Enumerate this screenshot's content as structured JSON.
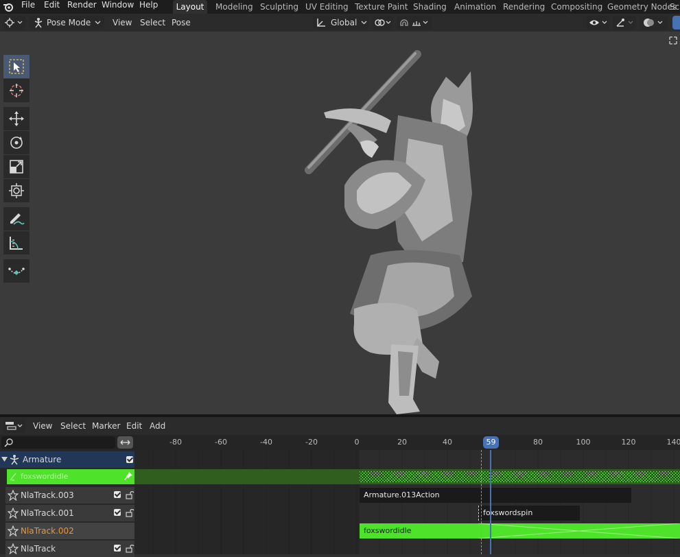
{
  "menu": {
    "items": [
      "File",
      "Edit",
      "Render",
      "Window",
      "Help"
    ]
  },
  "workspaces": {
    "tabs": [
      "Layout",
      "Modeling",
      "Sculpting",
      "UV Editing",
      "Texture Paint",
      "Shading",
      "Animation",
      "Rendering",
      "Compositing",
      "Geometry Nodes",
      "Sc"
    ],
    "active": "Layout"
  },
  "viewport_header": {
    "mode": "Pose Mode",
    "menus": [
      "View",
      "Select",
      "Pose"
    ],
    "orientation": "Global"
  },
  "toolbar": {
    "tools": [
      "select-box",
      "cursor",
      "move",
      "rotate",
      "scale",
      "transform",
      "annotate",
      "measure",
      "pose-breakdowner"
    ],
    "active": "select-box"
  },
  "nla_header": {
    "menus": [
      "View",
      "Select",
      "Marker",
      "Edit",
      "Add"
    ]
  },
  "timeline": {
    "ticks": [
      "-80",
      "-60",
      "-40",
      "-20",
      "0",
      "20",
      "40",
      "60",
      "80",
      "100",
      "120",
      "140"
    ],
    "current_frame": "59"
  },
  "tracks": {
    "object": "Armature",
    "action_line": "foxswordidle",
    "rows": [
      {
        "name": "NlaTrack.003",
        "highlight": false
      },
      {
        "name": "NlaTrack.001",
        "highlight": false
      },
      {
        "name": "NlaTrack.002",
        "highlight": true
      },
      {
        "name": "NlaTrack",
        "highlight": false
      }
    ]
  },
  "strips": {
    "action_013": "Armature.013Action",
    "swordspin": "foxswordspin",
    "swordidle": "foxswordidle"
  },
  "colors": {
    "accent_blue": "#4772b3",
    "action_green": "#4ee22a",
    "object_row": "#213758",
    "track_highlight": "#e8953a"
  }
}
